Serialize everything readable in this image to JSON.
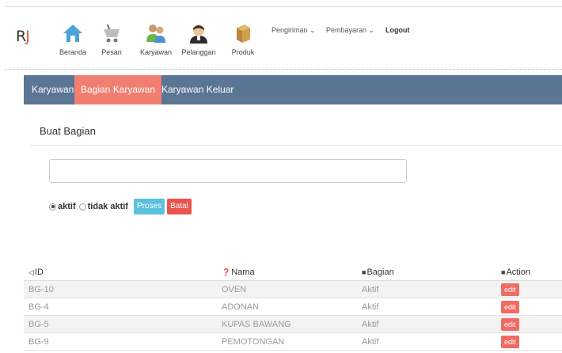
{
  "header": {
    "brand": {
      "r": "R",
      "j": "J"
    },
    "nav": [
      {
        "label": "Beranda",
        "icon": "home-icon"
      },
      {
        "label": "Pesan",
        "icon": "cart-icon"
      },
      {
        "label": "Karyawan",
        "icon": "users-icon"
      },
      {
        "label": "Pelanggan",
        "icon": "customer-icon"
      },
      {
        "label": "Produk",
        "icon": "box-icon"
      }
    ],
    "dropdowns": [
      {
        "label": "Pengiriman ⌄"
      },
      {
        "label": "Pembayaran ⌄"
      },
      {
        "label": "Logout"
      }
    ]
  },
  "tabs": [
    {
      "label": "Karyawan"
    },
    {
      "label": "Bagian Karyawan"
    },
    {
      "label": "Karyawan Keluar"
    }
  ],
  "form": {
    "title": "Buat Bagian",
    "input_value": "",
    "radio_active_label": "aktif",
    "radio_inactive_label": "tidak aktif",
    "proses_label": "Proses",
    "batal_label": "Batal"
  },
  "table": {
    "headers": {
      "id": "ID",
      "nama": "Nama",
      "bagian": "Bagian",
      "action": "Action"
    },
    "rows": [
      {
        "id": "BG-10",
        "nama": "OVEN",
        "status": "Aktif",
        "action": "edit"
      },
      {
        "id": "BG-4",
        "nama": "ADONAN",
        "status": "Aktif",
        "action": "edit"
      },
      {
        "id": "BG-5",
        "nama": "KUPAS BAWANG",
        "status": "Aktif",
        "action": "edit"
      },
      {
        "id": "BG-9",
        "nama": "PEMOTONGAN",
        "status": "Aktif",
        "action": "edit"
      }
    ]
  },
  "colors": {
    "tabbar": "#5b7594",
    "active_tab": "#f07f71",
    "proses": "#5bc0de",
    "batal": "#e8544b",
    "edit": "#f06b63"
  }
}
